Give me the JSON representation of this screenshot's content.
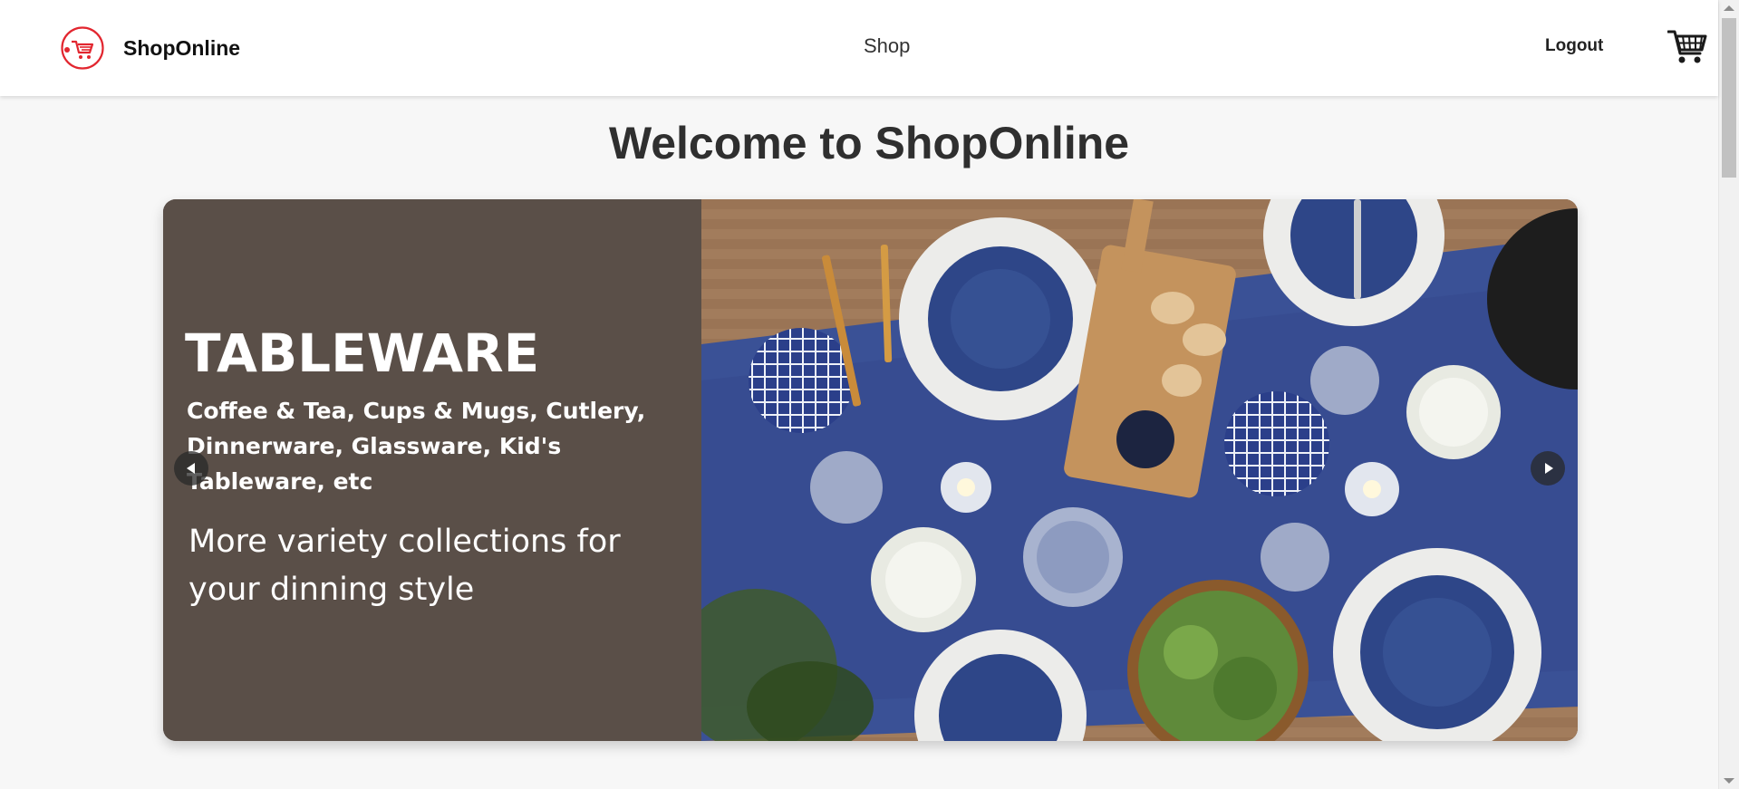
{
  "header": {
    "brand_name": "ShopOnline",
    "brand_color": "#e2262f",
    "nav": {
      "shop_label": "Shop"
    },
    "logout_label": "Logout",
    "icons": {
      "logo": "shopping-cart-logo-icon",
      "cart": "shopping-cart-icon"
    }
  },
  "main": {
    "title": "Welcome to ShopOnline",
    "carousel": {
      "slide": {
        "heading": "TABLEWARE",
        "subheading": "Coffee & Tea, Cups & Mugs, Cutlery, Dinnerware, Glassware, Kid's Tableware, etc",
        "tagline": "More variety collections for your dinning style",
        "panel_color": "#5a4f48",
        "image_description": "tableware-table-setting-photo"
      },
      "controls": {
        "prev_icon": "triangle-left-icon",
        "next_icon": "triangle-right-icon"
      }
    }
  }
}
